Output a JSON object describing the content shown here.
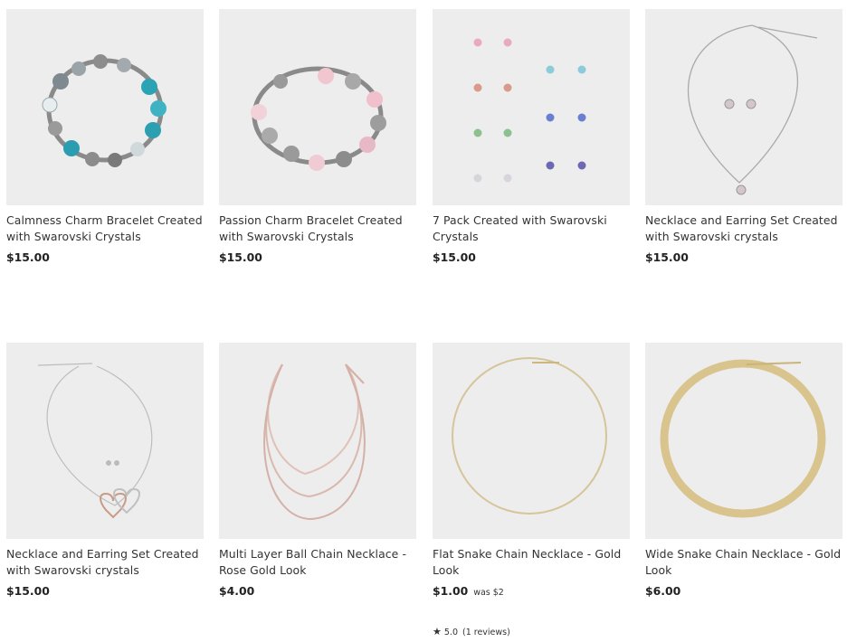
{
  "products": [
    {
      "title": "Calmness Charm Bracelet Created with Swarovski Crystals",
      "price": "$15.00"
    },
    {
      "title": "Passion Charm Bracelet Created with Swarovski Crystals",
      "price": "$15.00"
    },
    {
      "title": "7 Pack Created with Swarovski Crystals",
      "price": "$15.00"
    },
    {
      "title": "Necklace and Earring Set Created with Swarovski crystals",
      "price": "$15.00"
    },
    {
      "title": "Necklace and Earring Set Created with Swarovski crystals",
      "price": "$15.00"
    },
    {
      "title": "Multi Layer Ball Chain Necklace - Rose Gold Look",
      "price": "$4.00"
    },
    {
      "title": "Flat Snake Chain Necklace - Gold Look",
      "price": "$1.00",
      "was": "was $2",
      "rating": "5.0",
      "reviews": "(1 reviews)"
    },
    {
      "title": "Wide Snake Chain Necklace - Gold Look",
      "price": "$6.00"
    }
  ],
  "icons": {
    "rating_star": "star-icon"
  },
  "colors": {
    "thumb_bg": "#ededed",
    "text": "#333333"
  }
}
